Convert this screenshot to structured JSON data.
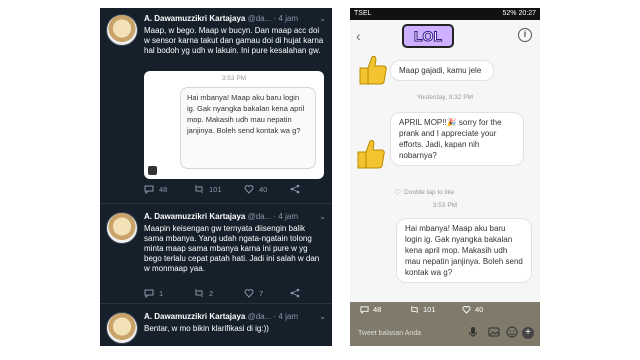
{
  "left": {
    "tweets": [
      {
        "name": "A. Dawamuzzikri Kartajaya",
        "handle": "@da...",
        "time": "· 4 jam",
        "text": "Maap, w bego. Maap w bucyn. Dan maap acc doi w sensor karna takut dan gamau doi di hujat karna hal bodoh yg udh w lakuin. Ini pure kesalahan gw.",
        "embed": {
          "time": "3:53 PM",
          "message": "Hai mbanya! Maap aku baru login ig. Gak nyangka bakalan kena april mop. Makasih udh mau nepatin janjinya. Boleh send kontak wa g?"
        },
        "replies": "48",
        "retweets": "101",
        "likes": "40"
      },
      {
        "name": "A. Dawamuzzikri Kartajaya",
        "handle": "@da...",
        "time": "· 4 jam",
        "text": "Maapin keisengan gw ternyata diisengin balik sama mbanya. Yang udah ngata-ngatain tolong minta maap sama mbanya karna ini pure w yg bego terlalu cepat patah hati. Jadi ini salah w dan w monmaap yaa.",
        "replies": "1",
        "retweets": "2",
        "likes": "7"
      },
      {
        "name": "A. Dawamuzzikri Kartajaya",
        "handle": "@da...",
        "time": "· 4 jam",
        "text": "Bentar, w mo bikin klarifikasi di ig:))"
      }
    ]
  },
  "right": {
    "status_left": "TSEL",
    "status_right": "52% 20:27",
    "sticker": "LOL",
    "msg1": "Maap gajadi, kamu jele",
    "stamp1": "Yesterday, 9:32 PM",
    "msg2": "APRIL MOP!!🎉 sorry for the prank and I appreciate your efforts. Jadi, kapan nih nobarnya?",
    "like_hint": "Double tap to like",
    "stamp2": "3:53 PM",
    "msg3": "Hai mbanya! Maap aku baru login ig. Gak nyangka bakalan kena april mop. Makasih udh mau nepatin janjinya. Boleh send kontak wa g?",
    "composer": {
      "replies": "48",
      "retweets": "101",
      "likes": "40",
      "placeholder": "Tweet balasan Anda"
    }
  },
  "colors": {
    "twitter_bg": "#15202b",
    "chat_bg": "#f6f6f6",
    "thumb": "#f4c430"
  }
}
